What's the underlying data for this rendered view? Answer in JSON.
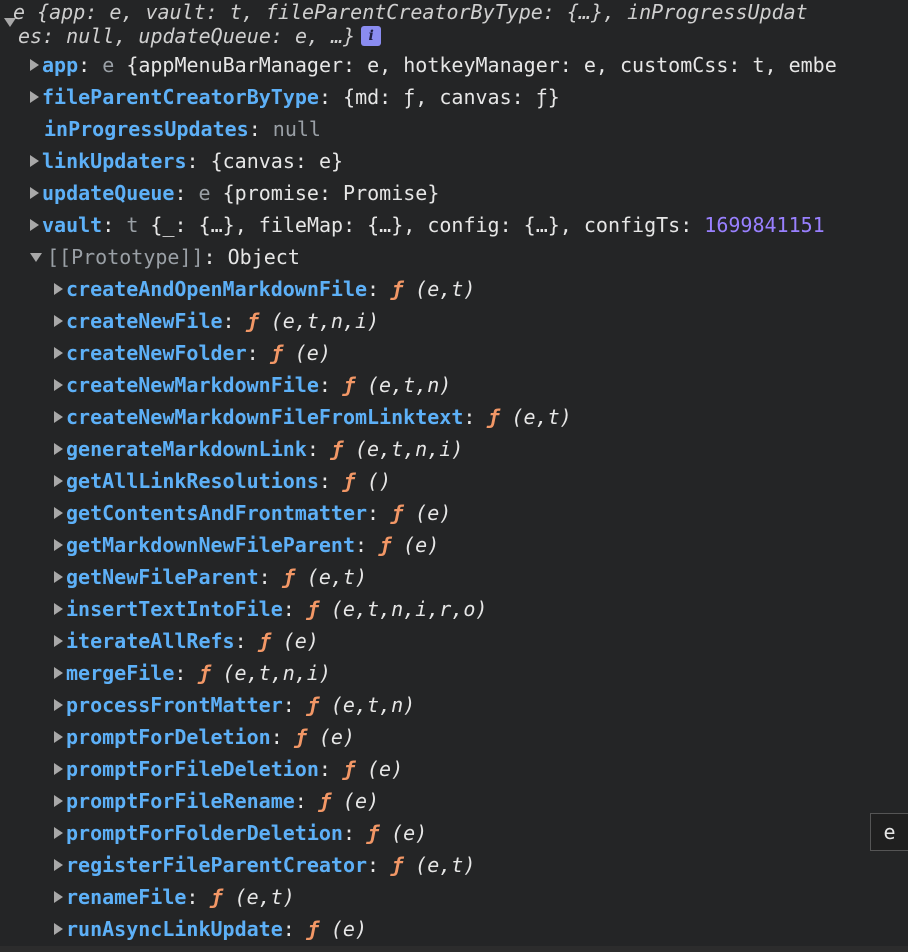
{
  "header": {
    "line1": "e {app: e, vault: t, fileParentCreatorByType: {…}, inProgressUpdat",
    "line2": "es: null, updateQueue: e, …}",
    "info_badge": "i"
  },
  "properties": [
    {
      "key": "app",
      "sep": ": ",
      "value_prefix": "e ",
      "value": "{appMenuBarManager: e, hotkeyManager: e, customCss: t, embe",
      "expandable": true
    },
    {
      "key": "fileParentCreatorByType",
      "sep": ": ",
      "value_prefix": "",
      "value": "{md: ƒ, canvas: ƒ}",
      "expandable": true
    },
    {
      "key": "inProgressUpdates",
      "sep": ": ",
      "value_prefix": "",
      "value": "null",
      "expandable": false
    },
    {
      "key": "linkUpdaters",
      "sep": ": ",
      "value_prefix": "",
      "value": "{canvas: e}",
      "expandable": true
    },
    {
      "key": "updateQueue",
      "sep": ": ",
      "value_prefix": "e ",
      "value": "{promise: Promise}",
      "expandable": true
    },
    {
      "key": "vault",
      "sep": ": ",
      "value_prefix": "t ",
      "value": "{_: {…}, fileMap: {…}, config: {…}, configTs: ",
      "number": "1699841151",
      "expandable": true
    }
  ],
  "prototype": {
    "label": "[[Prototype]]",
    "sep": ": ",
    "value": "Object"
  },
  "methods": [
    {
      "name": "createAndOpenMarkdownFile",
      "args": "(e,t)"
    },
    {
      "name": "createNewFile",
      "args": "(e,t,n,i)"
    },
    {
      "name": "createNewFolder",
      "args": "(e)"
    },
    {
      "name": "createNewMarkdownFile",
      "args": "(e,t,n)"
    },
    {
      "name": "createNewMarkdownFileFromLinktext",
      "args": "(e,t)"
    },
    {
      "name": "generateMarkdownLink",
      "args": "(e,t,n,i)"
    },
    {
      "name": "getAllLinkResolutions",
      "args": "()"
    },
    {
      "name": "getContentsAndFrontmatter",
      "args": "(e)"
    },
    {
      "name": "getMarkdownNewFileParent",
      "args": "(e)"
    },
    {
      "name": "getNewFileParent",
      "args": "(e,t)"
    },
    {
      "name": "insertTextIntoFile",
      "args": "(e,t,n,i,r,o)"
    },
    {
      "name": "iterateAllRefs",
      "args": "(e)"
    },
    {
      "name": "mergeFile",
      "args": "(e,t,n,i)"
    },
    {
      "name": "processFrontMatter",
      "args": "(e,t,n)"
    },
    {
      "name": "promptForDeletion",
      "args": "(e)"
    },
    {
      "name": "promptForFileDeletion",
      "args": "(e)"
    },
    {
      "name": "promptForFileRename",
      "args": "(e)"
    },
    {
      "name": "promptForFolderDeletion",
      "args": "(e)"
    },
    {
      "name": "registerFileParentCreator",
      "args": "(e,t)"
    },
    {
      "name": "renameFile",
      "args": "(e,t)"
    },
    {
      "name": "runAsyncLinkUpdate",
      "args": "(e)"
    }
  ],
  "fn_glyph": "ƒ",
  "tooltip": "e"
}
